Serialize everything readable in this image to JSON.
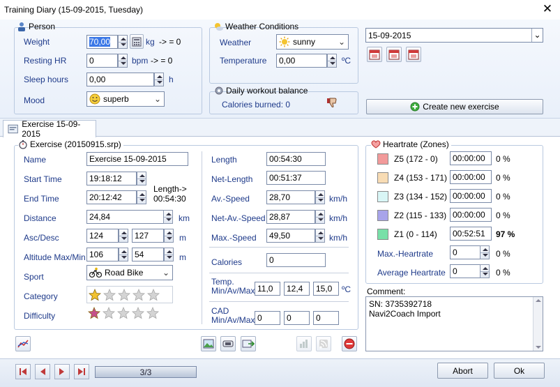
{
  "window": {
    "title": "Training Diary (15-09-2015, Tuesday)"
  },
  "person": {
    "title": "Person",
    "weight": {
      "label": "Weight",
      "value": "70,00",
      "unit": "kg",
      "result": "-> = 0"
    },
    "resting_hr": {
      "label": "Resting HR",
      "value": "0",
      "unit": "bpm",
      "result": "-> = 0"
    },
    "sleep": {
      "label": "Sleep hours",
      "value": "0,00",
      "unit": "h"
    },
    "mood": {
      "label": "Mood",
      "value": "superb"
    }
  },
  "weather": {
    "title": "Weather Conditions",
    "weather": {
      "label": "Weather",
      "value": "sunny"
    },
    "temperature": {
      "label": "Temperature",
      "value": "0,00",
      "unit": "ºC"
    }
  },
  "balance": {
    "title": "Daily workout balance",
    "calories": "Calories burned: 0"
  },
  "date_picker": {
    "value": "15-09-2015"
  },
  "create_exercise": {
    "label": "Create new exercise"
  },
  "tab": {
    "label": "Exercise 15-09-2015"
  },
  "exercise": {
    "title": "Exercise (20150915.srp)",
    "name": {
      "label": "Name",
      "value": "Exercise 15-09-2015"
    },
    "start": {
      "label": "Start Time",
      "value": "19:18:12"
    },
    "end": {
      "label": "End Time",
      "value": "20:12:42"
    },
    "length_note": {
      "line1": "Length->",
      "line2": "00:54:30"
    },
    "distance": {
      "label": "Distance",
      "value": "24,84",
      "unit": "km"
    },
    "ascdesc": {
      "label": "Asc/Desc",
      "asc": "124",
      "desc": "127",
      "unit": "m"
    },
    "altitude": {
      "label": "Altitude Max/Min",
      "max": "106",
      "min": "54",
      "unit": "m"
    },
    "sport": {
      "label": "Sport",
      "value": "Road Bike"
    },
    "category": {
      "label": "Category",
      "rating": 1,
      "max": 5
    },
    "difficulty": {
      "label": "Difficulty",
      "rating": 1,
      "max": 5
    },
    "length": {
      "label": "Length",
      "value": "00:54:30"
    },
    "net_length": {
      "label": "Net-Length",
      "value": "00:51:37"
    },
    "av_speed": {
      "label": "Av.-Speed",
      "value": "28,70",
      "unit": "km/h"
    },
    "net_av_speed": {
      "label": "Net-Av.-Speed",
      "value": "28,87",
      "unit": "km/h"
    },
    "max_speed": {
      "label": "Max.-Speed",
      "value": "49,50",
      "unit": "km/h"
    },
    "calories": {
      "label": "Calories",
      "value": "0"
    },
    "temp": {
      "label1": "Temp.",
      "label2": "Min/Av/Max",
      "min": "11,0",
      "av": "12,4",
      "max": "15,0",
      "unit": "ºC"
    },
    "cad": {
      "label1": "CAD",
      "label2": "Min/Av/Max",
      "min": "0",
      "av": "0",
      "max": "0"
    }
  },
  "heartrate": {
    "title": "Heartrate (Zones)",
    "zones": [
      {
        "label": "Z5 (172 - 0)",
        "time": "00:00:00",
        "pct": "0 %",
        "color": "#f29a9a",
        "bold": false
      },
      {
        "label": "Z4 (153 - 171)",
        "time": "00:00:00",
        "pct": "0 %",
        "color": "#f8dcb4",
        "bold": false
      },
      {
        "label": "Z3 (134 - 152)",
        "time": "00:00:00",
        "pct": "0 %",
        "color": "#d9f6f6",
        "bold": false
      },
      {
        "label": "Z2 (115 - 133)",
        "time": "00:00:00",
        "pct": "0 %",
        "color": "#a8a4ea",
        "bold": false
      },
      {
        "label": "Z1 (0 - 114)",
        "time": "00:52:51",
        "pct": "97 %",
        "color": "#78e0a8",
        "bold": true
      }
    ],
    "max_hr": {
      "label": "Max.-Heartrate",
      "value": "0",
      "pct": "0 %"
    },
    "avg_hr": {
      "label": "Average Heartrate",
      "value": "0",
      "pct": "0 %"
    }
  },
  "comment": {
    "label": "Comment:",
    "line1": "SN: 3735392718",
    "line2": "Navi2Coach Import"
  },
  "navigator": {
    "position": "3/3",
    "progress": 1.0
  },
  "actions": {
    "abort": "Abort",
    "ok": "Ok"
  },
  "colors": {
    "accent": "#3b78e7",
    "label": "#1e3a8a",
    "border": "#b9c9e0"
  }
}
